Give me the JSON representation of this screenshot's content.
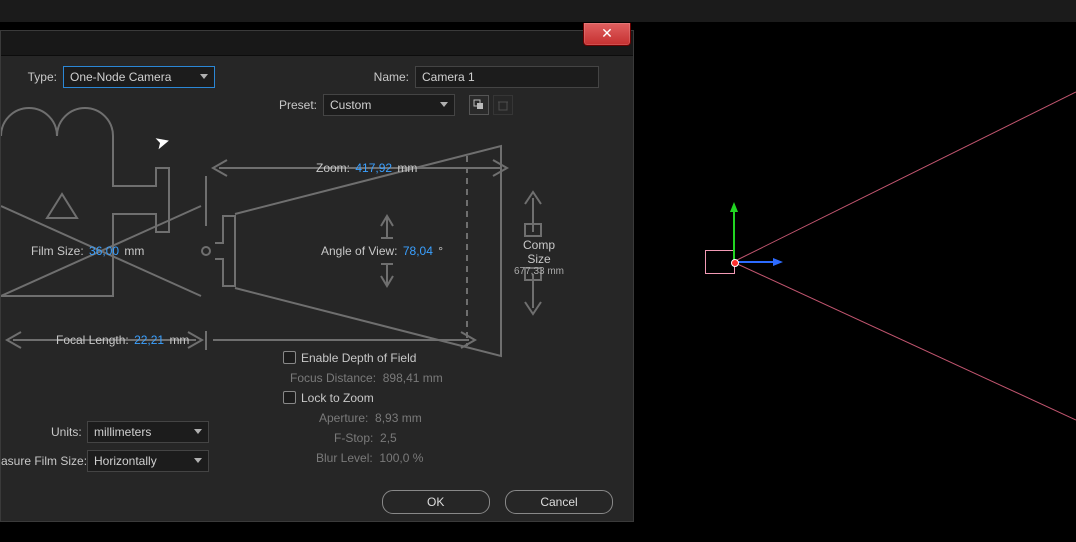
{
  "header": {
    "type_label": "Type:",
    "type_value": "One-Node Camera",
    "name_label": "Name:",
    "name_value": "Camera 1",
    "preset_label": "Preset:",
    "preset_value": "Custom"
  },
  "diagram": {
    "zoom_label": "Zoom:",
    "zoom_value": "417,92",
    "zoom_unit": "mm",
    "film_size_label": "Film Size:",
    "film_size_value": "36,00",
    "film_size_unit": "mm",
    "aov_label": "Angle of View:",
    "aov_value": "78,04",
    "aov_unit": "°",
    "comp_size_label": "Comp Size",
    "comp_size_value": "677,33 mm",
    "focal_length_label": "Focal Length:",
    "focal_length_value": "22,21",
    "focal_length_unit": "mm"
  },
  "settings": {
    "enable_dof": "Enable Depth of Field",
    "focus_distance_label": "Focus Distance:",
    "focus_distance_value": "898,41 mm",
    "lock_zoom": "Lock to Zoom",
    "aperture_label": "Aperture:",
    "aperture_value": "8,93 mm",
    "fstop_label": "F-Stop:",
    "fstop_value": "2,5",
    "blur_label": "Blur Level:",
    "blur_value": "100,0 %",
    "units_label": "Units:",
    "units_value": "millimeters",
    "measure_label": "asure Film Size:",
    "measure_value": "Horizontally"
  },
  "buttons": {
    "ok": "OK",
    "cancel": "Cancel"
  }
}
